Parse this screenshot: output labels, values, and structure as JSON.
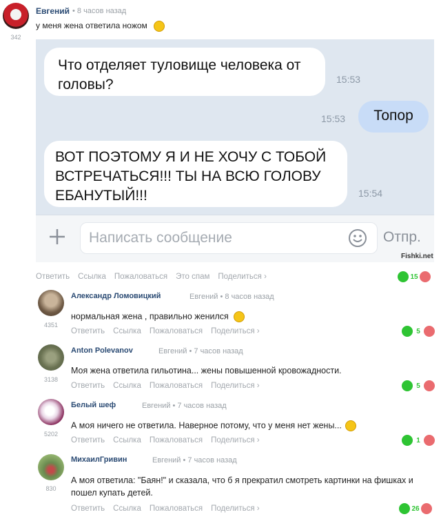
{
  "post": {
    "author": "Евгений",
    "time": "• 8 часов назад",
    "score": "342",
    "text": "у меня жена ответила ножом",
    "emoji_icon": "grinning-emoji",
    "screenshot": {
      "messages": [
        {
          "text": "Что отделяет туловище человека от головы?",
          "time": "15:53",
          "direction": "incoming"
        },
        {
          "text": "Топор",
          "time": "15:53",
          "direction": "outgoing"
        },
        {
          "text": "ВОТ ПОЭТОМУ Я И НЕ ХОЧУ С ТОБОЙ ВСТРЕЧАТЬСЯ!!! ТЫ НА ВСЮ ГОЛОВУ ЕБАНУТЫЙ!!!",
          "time": "15:54",
          "direction": "incoming"
        }
      ],
      "input_placeholder": "Написать сообщение",
      "send_label": "Отпр.",
      "watermark": "Fishki.net"
    },
    "actions": [
      "Ответить",
      "Ссылка",
      "Пожаловаться",
      "Это спам",
      "Поделиться ›"
    ],
    "votes": "15"
  },
  "comments": [
    {
      "author": "Александр Ломовицкий",
      "reply_to": "Евгений",
      "time": "• 8 часов назад",
      "score": "4351",
      "text": "нормальная жена , правильно женился",
      "emoji_icon": "thumbs-up-emoji",
      "actions": [
        "Ответить",
        "Ссылка",
        "Пожаловаться",
        "Поделиться ›"
      ],
      "votes": "5"
    },
    {
      "author": "Anton Polevanov",
      "reply_to": "Евгений",
      "time": "• 7 часов назад",
      "score": "3138",
      "text": "Моя жена ответила гильотина... жены повышенной кровожадности.",
      "actions": [
        "Ответить",
        "Ссылка",
        "Пожаловаться",
        "Поделиться ›"
      ],
      "votes": "5"
    },
    {
      "author": "Белый шеф",
      "reply_to": "Евгений",
      "time": "• 7 часов назад",
      "score": "5202",
      "text": "А моя ничего не ответила. Наверное потому, что у меня нет жены...",
      "emoji_icon": "laughing-emoji",
      "actions": [
        "Ответить",
        "Ссылка",
        "Пожаловаться",
        "Поделиться ›"
      ],
      "votes": "1"
    },
    {
      "author": "МихаилГривин",
      "reply_to": "Евгений",
      "time": "• 7 часов назад",
      "score": "830",
      "text_line1": "А моя ответила: \"Баян!\" и сказала, что б я прекратил смотреть картинки на фишках и",
      "text_line2": "пошел купать детей.",
      "actions": [
        "Ответить",
        "Ссылка",
        "Пожаловаться",
        "Поделиться ›"
      ],
      "votes": "26"
    }
  ],
  "colors": {
    "upvote": "#2ec433",
    "downvote": "#ea6b6f",
    "author": "#2a4a73",
    "chat_bg": "#dfe7f0",
    "outgoing_bubble": "#c8dcf7"
  }
}
